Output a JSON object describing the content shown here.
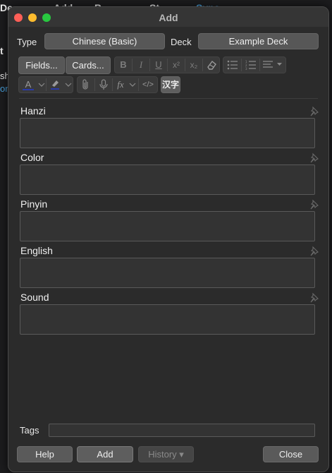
{
  "background_app": {
    "menu_items": [
      "De",
      "Add",
      "B",
      "St",
      "Sync"
    ],
    "left_fragments": [
      "t",
      "sh",
      "on"
    ]
  },
  "window": {
    "title": "Add"
  },
  "top_row": {
    "type_label": "Type",
    "type_value": "Chinese (Basic)",
    "deck_label": "Deck",
    "deck_value": "Example Deck"
  },
  "toolbar": {
    "fields_label": "Fields...",
    "cards_label": "Cards...",
    "bold": "B",
    "italic": "I",
    "underline": "U",
    "superscript": "x²",
    "subscript": "x₂",
    "text_color_glyph": "A",
    "math_glyph": "fx",
    "html_glyph": "</>",
    "chinese_button": "汉字"
  },
  "fields": [
    {
      "label": "Hanzi",
      "value": ""
    },
    {
      "label": "Color",
      "value": ""
    },
    {
      "label": "Pinyin",
      "value": ""
    },
    {
      "label": "English",
      "value": ""
    },
    {
      "label": "Sound",
      "value": ""
    }
  ],
  "tags": {
    "label": "Tags",
    "value": ""
  },
  "buttons": {
    "help": "Help",
    "add": "Add",
    "history": "History ▾",
    "close": "Close"
  },
  "colors": {
    "close_dot": "#fe5f57",
    "minimize_dot": "#febc2e",
    "maximize_dot": "#28c840",
    "text_color_bar": "#2a3aa8",
    "highlight_color_bar": "#2a3aa8",
    "accent_blue": "#4aa3df"
  }
}
